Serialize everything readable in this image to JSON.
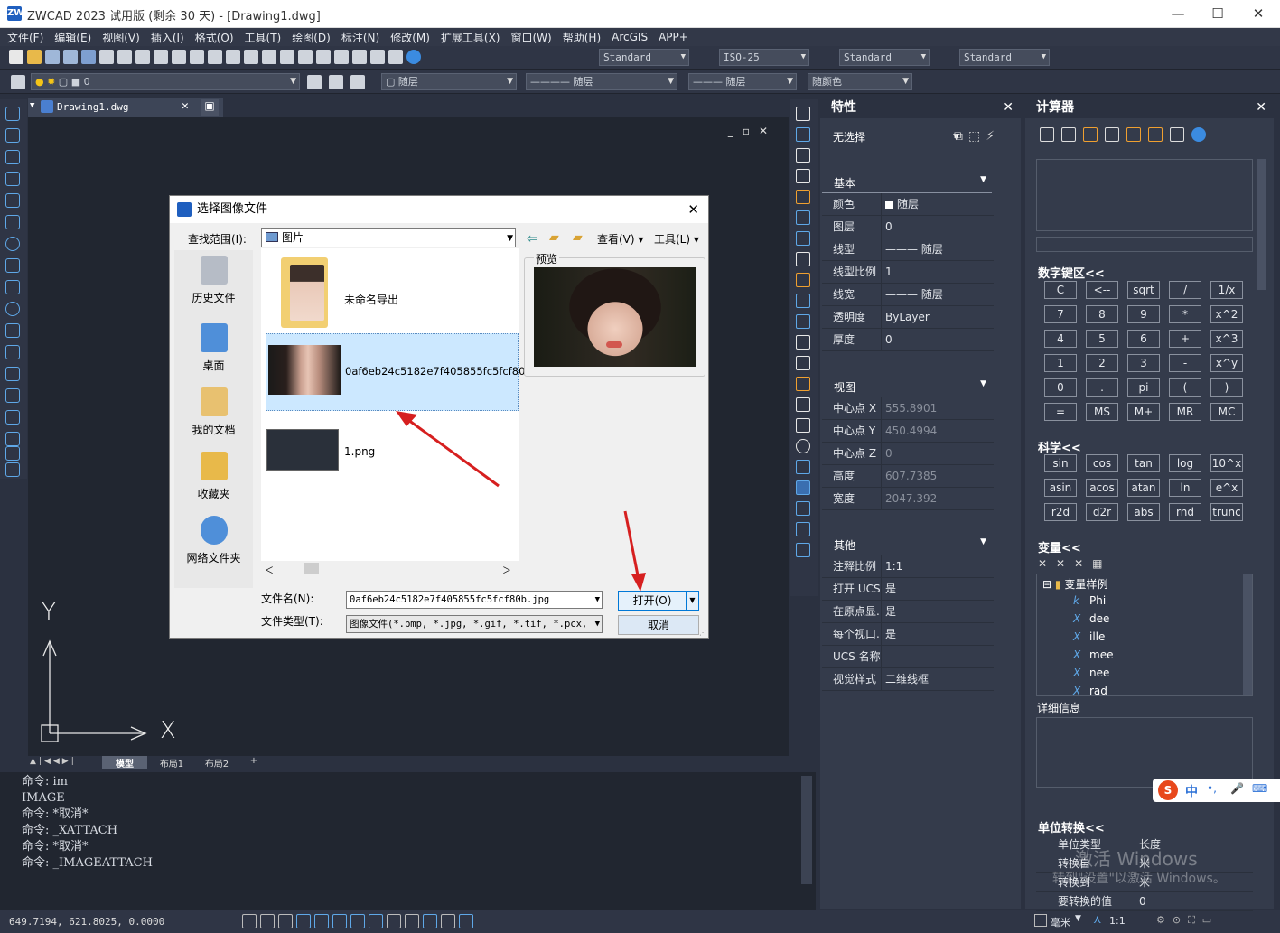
{
  "window": {
    "title": "ZWCAD 2023 试用版 (剩余 30 天) - [Drawing1.dwg]",
    "logo": "ZW",
    "min": "—",
    "max": "☐",
    "close": "✕"
  },
  "menu": [
    "文件(F)",
    "编辑(E)",
    "视图(V)",
    "插入(I)",
    "格式(O)",
    "工具(T)",
    "绘图(D)",
    "标注(N)",
    "修改(M)",
    "扩展工具(X)",
    "窗口(W)",
    "帮助(H)",
    "ArcGIS",
    "APP+"
  ],
  "toolbar": {
    "text_style": "Standard",
    "dim_style": "ISO-25",
    "table_style": "Standard",
    "mleader_style": "Standard",
    "layer": "0",
    "color": "随层",
    "linetype": "随层",
    "lineweight": "随层",
    "plotstyle": "随颜色"
  },
  "doc_tab": {
    "label": "Drawing1.dwg",
    "close": "✕"
  },
  "layout_tabs": [
    "模型",
    "布局1",
    "布局2",
    "+"
  ],
  "axes": {
    "x": "X",
    "y": "Y"
  },
  "command_lines": [
    "命令: im",
    "IMAGE",
    "命令: *取消*",
    "命令: _XATTACH",
    "命令: *取消*",
    "命令: _IMAGEATTACH"
  ],
  "status": {
    "coords": "649.7194, 621.8025, 0.0000",
    "unit": "毫米",
    "scale": "1:1"
  },
  "properties": {
    "title": "特性",
    "selection": "无选择",
    "sections": {
      "basic": "基本",
      "view": "视图",
      "other": "其他"
    },
    "basic": [
      {
        "k": "颜色",
        "v": "随层"
      },
      {
        "k": "图层",
        "v": "0"
      },
      {
        "k": "线型",
        "v": "——— 随层"
      },
      {
        "k": "线型比例",
        "v": "1"
      },
      {
        "k": "线宽",
        "v": "——— 随层"
      },
      {
        "k": "透明度",
        "v": "ByLayer"
      },
      {
        "k": "厚度",
        "v": "0"
      }
    ],
    "view": [
      {
        "k": "中心点 X",
        "v": "555.8901"
      },
      {
        "k": "中心点 Y",
        "v": "450.4994"
      },
      {
        "k": "中心点 Z",
        "v": "0"
      },
      {
        "k": "高度",
        "v": "607.7385"
      },
      {
        "k": "宽度",
        "v": "2047.392"
      }
    ],
    "other": [
      {
        "k": "注释比例",
        "v": "1:1"
      },
      {
        "k": "打开 UCS...",
        "v": "是"
      },
      {
        "k": "在原点显...",
        "v": "是"
      },
      {
        "k": "每个视口...",
        "v": "是"
      },
      {
        "k": "UCS 名称",
        "v": ""
      },
      {
        "k": "视觉样式",
        "v": "二维线框"
      }
    ]
  },
  "calculator": {
    "title": "计算器",
    "numpad_title": "数字键区<<",
    "science_title": "科学<<",
    "var_title": "变量<<",
    "detail_title": "详细信息",
    "unit_title": "单位转换<<",
    "numpad": [
      [
        "C",
        "<--",
        "sqrt",
        "/",
        "1/x"
      ],
      [
        "7",
        "8",
        "9",
        "*",
        "x^2"
      ],
      [
        "4",
        "5",
        "6",
        "+",
        "x^3"
      ],
      [
        "1",
        "2",
        "3",
        "-",
        "x^y"
      ],
      [
        "0",
        ".",
        "pi",
        "(",
        ")"
      ],
      [
        "=",
        "MS",
        "M+",
        "MR",
        "MC"
      ]
    ],
    "science": [
      [
        "sin",
        "cos",
        "tan",
        "log",
        "10^x"
      ],
      [
        "asin",
        "acos",
        "atan",
        "ln",
        "e^x"
      ],
      [
        "r2d",
        "d2r",
        "abs",
        "rnd",
        "trunc"
      ]
    ],
    "var_root": "变量样例",
    "vars": [
      {
        "icon": "k",
        "name": "Phi"
      },
      {
        "icon": "X",
        "name": "dee"
      },
      {
        "icon": "X",
        "name": "ille"
      },
      {
        "icon": "X",
        "name": "mee"
      },
      {
        "icon": "X",
        "name": "nee"
      },
      {
        "icon": "X",
        "name": "rad"
      }
    ],
    "unit_rows": [
      {
        "k": "单位类型",
        "v": "长度"
      },
      {
        "k": "转换自",
        "v": "米"
      },
      {
        "k": "转换到",
        "v": "米"
      },
      {
        "k": "要转换的值",
        "v": "0"
      }
    ]
  },
  "watermark": {
    "line1": "激活 Windows",
    "line2": "转到\"设置\"以激活 Windows。"
  },
  "ime": {
    "logo": "S",
    "lang": "中",
    "punct": "•,"
  },
  "dialog": {
    "title": "选择图像文件",
    "close": "✕",
    "lookin_label": "查找范围(I):",
    "lookin_value": "图片",
    "view_menu": "查看(V)",
    "tools_menu": "工具(L)",
    "preview_label": "预览",
    "places": [
      "历史文件",
      "桌面",
      "我的文档",
      "收藏夹",
      "网络文件夹"
    ],
    "files": [
      {
        "name": "未命名导出"
      },
      {
        "name": "0af6eb24c5182e7f405855fc5fcf80"
      },
      {
        "name": "1.png"
      }
    ],
    "filename_label": "文件名(N):",
    "filename_value": "0af6eb24c5182e7f405855fc5fcf80b.jpg",
    "filetype_label": "文件类型(T):",
    "filetype_value": "图像文件(*.bmp, *.jpg, *.gif, *.tif, *.pcx,",
    "open_button": "打开(O)",
    "cancel_button": "取消"
  }
}
